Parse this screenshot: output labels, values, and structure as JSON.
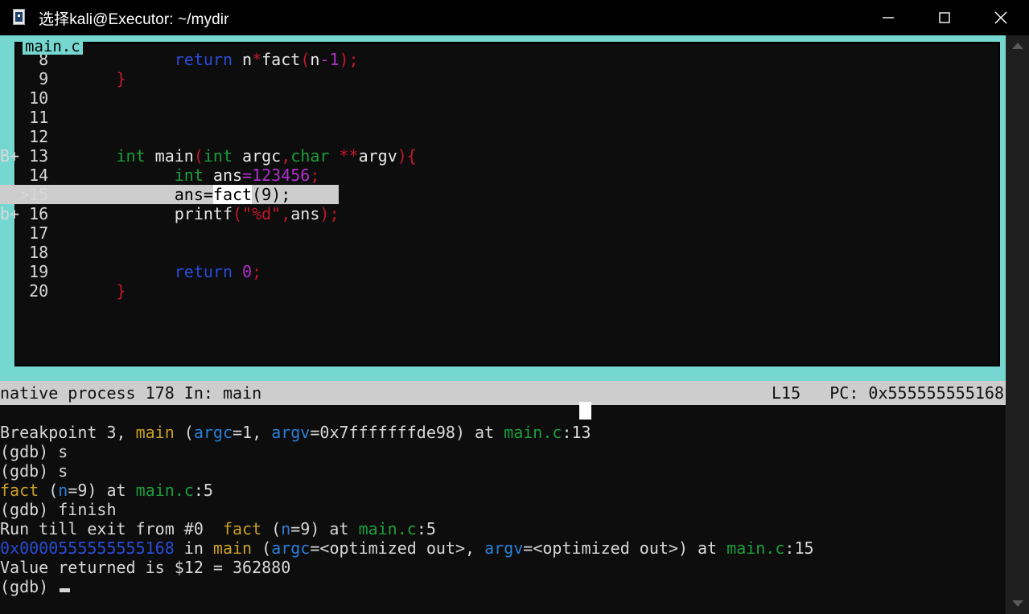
{
  "window": {
    "title": "选择kali@Executor: ~/mydir",
    "icon": "terminal-document-icon",
    "controls": {
      "minimize": "minimize-icon",
      "maximize": "maximize-icon",
      "close": "close-icon"
    }
  },
  "tui": {
    "border_color": "#76d7d0",
    "filename_label": "main.c",
    "source_lines": [
      {
        "mark": "   ",
        "num": " 8",
        "indent": "            ",
        "current": false,
        "tokens": [
          {
            "t": "return",
            "c": "kw"
          },
          {
            "t": " ",
            "c": "id"
          },
          {
            "t": "n",
            "c": "id"
          },
          {
            "t": "*",
            "c": "pun"
          },
          {
            "t": "fact",
            "c": "id"
          },
          {
            "t": "(",
            "c": "pun"
          },
          {
            "t": "n",
            "c": "id"
          },
          {
            "t": "-1",
            "c": "num"
          },
          {
            "t": ")",
            "c": "pun"
          },
          {
            "t": ";",
            "c": "pun"
          }
        ]
      },
      {
        "mark": "   ",
        "num": " 9",
        "indent": "      ",
        "current": false,
        "tokens": [
          {
            "t": "}",
            "c": "pun"
          }
        ]
      },
      {
        "mark": "   ",
        "num": "10",
        "indent": "",
        "current": false,
        "tokens": []
      },
      {
        "mark": "   ",
        "num": "11",
        "indent": "",
        "current": false,
        "tokens": []
      },
      {
        "mark": "   ",
        "num": "12",
        "indent": "",
        "current": false,
        "tokens": []
      },
      {
        "mark": "B+ ",
        "num": "13",
        "indent": "      ",
        "current": false,
        "tokens": [
          {
            "t": "int",
            "c": "type"
          },
          {
            "t": " main",
            "c": "id"
          },
          {
            "t": "(",
            "c": "pun"
          },
          {
            "t": "int",
            "c": "type"
          },
          {
            "t": " argc",
            "c": "id"
          },
          {
            "t": ",",
            "c": "pun"
          },
          {
            "t": "char",
            "c": "type"
          },
          {
            "t": " ",
            "c": "id"
          },
          {
            "t": "**",
            "c": "pun"
          },
          {
            "t": "argv",
            "c": "id"
          },
          {
            "t": ")",
            "c": "pun"
          },
          {
            "t": "{",
            "c": "pun"
          }
        ]
      },
      {
        "mark": "   ",
        "num": "14",
        "indent": "            ",
        "current": false,
        "tokens": [
          {
            "t": "int",
            "c": "type"
          },
          {
            "t": " ans",
            "c": "id"
          },
          {
            "t": "=",
            "c": "num"
          },
          {
            "t": "123456",
            "c": "num"
          },
          {
            "t": ";",
            "c": "pun"
          }
        ]
      },
      {
        "mark": "  >",
        "num": "15",
        "indent": "            ",
        "current": true,
        "tokens": [
          {
            "t": "ans",
            "c": "id"
          },
          {
            "t": "=",
            "c": "pun"
          },
          {
            "t": "fact",
            "c": "cursor"
          },
          {
            "t": "(",
            "c": "pun"
          },
          {
            "t": "9",
            "c": "num"
          },
          {
            "t": ")",
            "c": "pun"
          },
          {
            "t": ";",
            "c": "pun"
          }
        ]
      },
      {
        "mark": "b+ ",
        "num": "16",
        "indent": "            ",
        "current": false,
        "tokens": [
          {
            "t": "printf",
            "c": "id"
          },
          {
            "t": "(",
            "c": "pun"
          },
          {
            "t": "\"%d\"",
            "c": "str"
          },
          {
            "t": ",",
            "c": "pun"
          },
          {
            "t": "ans",
            "c": "id"
          },
          {
            "t": ")",
            "c": "pun"
          },
          {
            "t": ";",
            "c": "pun"
          }
        ]
      },
      {
        "mark": "   ",
        "num": "17",
        "indent": "",
        "current": false,
        "tokens": []
      },
      {
        "mark": "   ",
        "num": "18",
        "indent": "",
        "current": false,
        "tokens": []
      },
      {
        "mark": "   ",
        "num": "19",
        "indent": "            ",
        "current": false,
        "tokens": [
          {
            "t": "return",
            "c": "kw"
          },
          {
            "t": " ",
            "c": "id"
          },
          {
            "t": "0",
            "c": "num"
          },
          {
            "t": ";",
            "c": "pun"
          }
        ]
      },
      {
        "mark": "   ",
        "num": "20",
        "indent": "      ",
        "current": false,
        "tokens": [
          {
            "t": "}",
            "c": "pun"
          }
        ]
      }
    ]
  },
  "statusbar": {
    "left": "native process 178 In: main",
    "line": "L15",
    "pc_label": "PC:",
    "pc_value": "0x555555555168",
    "right": "L15   PC: 0x555555555168"
  },
  "console": {
    "lines": [
      {
        "segs": [
          {
            "t": "Breakpoint 3, ",
            "c": "txt"
          },
          {
            "t": "main",
            "c": "fn"
          },
          {
            "t": " (",
            "c": "txt"
          },
          {
            "t": "argc",
            "c": "var"
          },
          {
            "t": "=1, ",
            "c": "txt"
          },
          {
            "t": "argv",
            "c": "var"
          },
          {
            "t": "=0x7fffffffde98) at ",
            "c": "txt"
          },
          {
            "t": "main.c",
            "c": "file"
          },
          {
            "t": ":13",
            "c": "txt"
          }
        ]
      },
      {
        "segs": [
          {
            "t": "(gdb) s",
            "c": "txt"
          }
        ]
      },
      {
        "segs": [
          {
            "t": "(gdb) s",
            "c": "txt"
          }
        ]
      },
      {
        "segs": [
          {
            "t": "fact",
            "c": "fn"
          },
          {
            "t": " (",
            "c": "txt"
          },
          {
            "t": "n",
            "c": "var"
          },
          {
            "t": "=9) at ",
            "c": "txt"
          },
          {
            "t": "main.c",
            "c": "file"
          },
          {
            "t": ":5",
            "c": "txt"
          }
        ]
      },
      {
        "segs": [
          {
            "t": "(gdb) finish",
            "c": "txt"
          }
        ]
      },
      {
        "segs": [
          {
            "t": "Run till exit from #0  ",
            "c": "txt"
          },
          {
            "t": "fact",
            "c": "fn"
          },
          {
            "t": " (",
            "c": "txt"
          },
          {
            "t": "n",
            "c": "var"
          },
          {
            "t": "=9) at ",
            "c": "txt"
          },
          {
            "t": "main.c",
            "c": "file"
          },
          {
            "t": ":5",
            "c": "txt"
          }
        ]
      },
      {
        "segs": [
          {
            "t": "0x0000555555555168",
            "c": "addr"
          },
          {
            "t": " in ",
            "c": "txt"
          },
          {
            "t": "main",
            "c": "fn"
          },
          {
            "t": " (",
            "c": "txt"
          },
          {
            "t": "argc",
            "c": "var"
          },
          {
            "t": "=<optimized out>, ",
            "c": "txt"
          },
          {
            "t": "argv",
            "c": "var"
          },
          {
            "t": "=<optimized out>) at ",
            "c": "txt"
          },
          {
            "t": "main.c",
            "c": "file"
          },
          {
            "t": ":15",
            "c": "txt"
          }
        ]
      },
      {
        "segs": [
          {
            "t": "Value returned is $12 = 362880",
            "c": "txt"
          }
        ]
      }
    ],
    "prompt": "(gdb) "
  },
  "scrollbar": {
    "up": "scroll-up-arrow-icon",
    "down": "scroll-down-arrow-icon"
  }
}
